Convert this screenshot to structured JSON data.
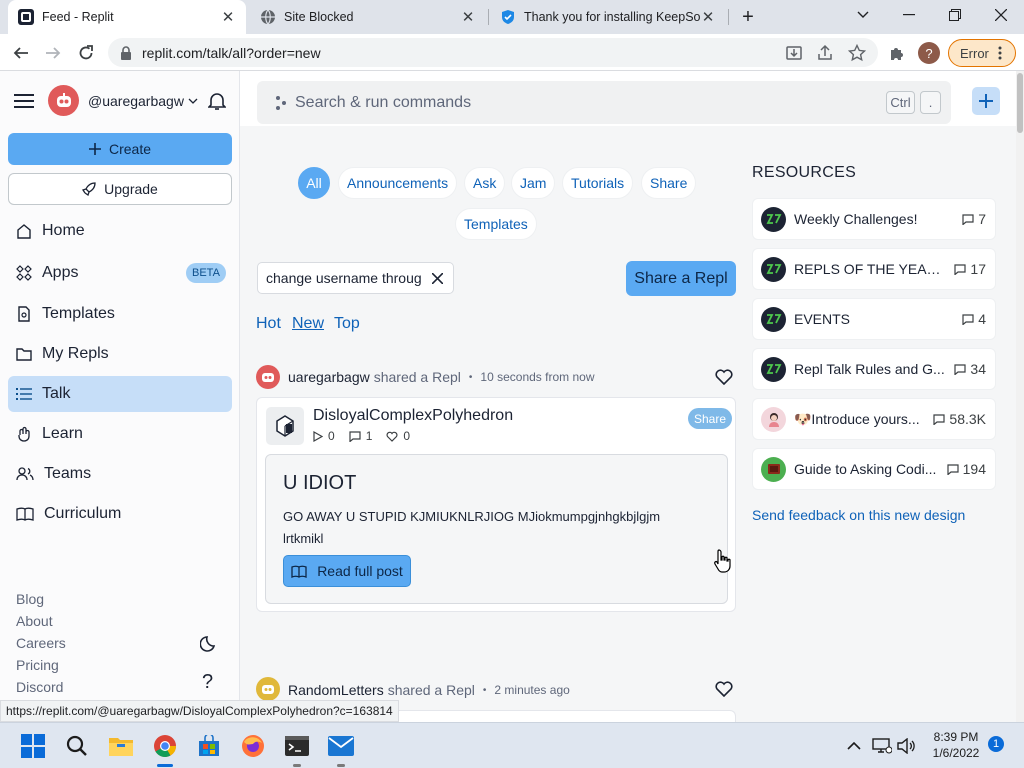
{
  "browser": {
    "tabs": [
      {
        "title": "Feed - Replit"
      },
      {
        "title": "Site Blocked"
      },
      {
        "title": "Thank you for installing KeepSolid"
      }
    ],
    "url": "replit.com/talk/all?order=new",
    "error_label": "Error",
    "profile_initial": "?",
    "status_url": "https://replit.com/@uaregarbagw/DisloyalComplexPolyhedron?c=163814"
  },
  "sidebar": {
    "username": "@uaregarbagw",
    "create_label": "Create",
    "upgrade_label": "Upgrade",
    "items": [
      {
        "label": "Home"
      },
      {
        "label": "Apps",
        "badge": "BETA"
      },
      {
        "label": "Templates"
      },
      {
        "label": "My Repls"
      },
      {
        "label": "Talk"
      },
      {
        "label": "Learn"
      },
      {
        "label": "Teams"
      },
      {
        "label": "Curriculum"
      }
    ],
    "footer_links": [
      "Blog",
      "About",
      "Careers",
      "Pricing",
      "Discord"
    ],
    "help_label": "?"
  },
  "search": {
    "placeholder": "Search & run commands",
    "key1": "Ctrl",
    "key2": "."
  },
  "filters": {
    "chips": [
      "All",
      "Announcements",
      "Ask",
      "Jam",
      "Tutorials",
      "Share",
      "Templates"
    ],
    "search_value": "change username throug",
    "share_repl_label": "Share a Repl",
    "sort": [
      "Hot",
      "New",
      "Top"
    ]
  },
  "posts": [
    {
      "author": "uaregarbagw",
      "action": "shared a Repl",
      "time": "10 seconds from now",
      "repl_name": "DisloyalComplexPolyhedron",
      "runs": "0",
      "comments": "1",
      "likes": "0",
      "tag": "Share",
      "title": "U IDIOT",
      "body": "GO AWAY U STUPID KJMIUKNLRJIOG MJiokmumpgjnhgkbjlgjm lrtkmikl",
      "read_label": "Read full post"
    },
    {
      "author": "RandomLetters",
      "action": "shared a Repl",
      "time": "2 minutes ago"
    }
  ],
  "resources": {
    "heading": "RESOURCES",
    "items": [
      {
        "title": "Weekly Challenges!",
        "count": "7"
      },
      {
        "title": "REPLS OF THE YEAR ...",
        "count": "17"
      },
      {
        "title": "EVENTS",
        "count": "4"
      },
      {
        "title": "Repl Talk Rules and G...",
        "count": "34"
      },
      {
        "title": "🐶Introduce yours...",
        "count": "58.3K"
      },
      {
        "title": "Guide to Asking Codi...",
        "count": "194"
      }
    ],
    "feedback_label": "Send feedback on this new design"
  },
  "taskbar": {
    "time": "8:39 PM",
    "date": "1/6/2022",
    "notification_count": "1"
  },
  "colors": {
    "accent": "#5aa9f2",
    "link": "#0f62b8",
    "active_nav": "#c6def8",
    "error_border": "#e37400"
  }
}
